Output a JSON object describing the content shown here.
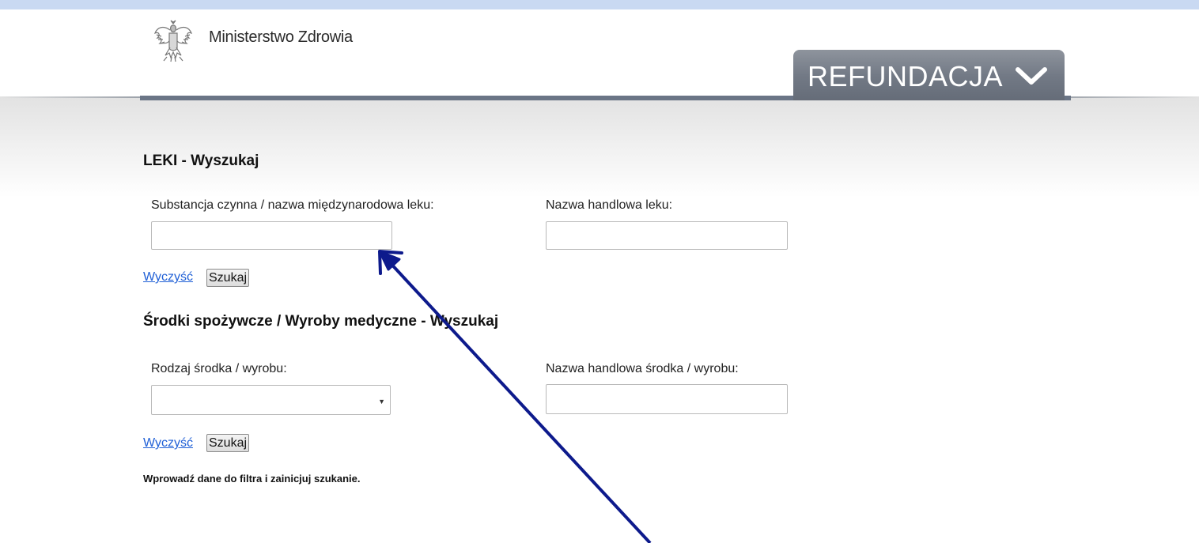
{
  "header": {
    "ministry_name": "Ministerstwo Zdrowia",
    "section_tab": "REFUNDACJA",
    "tab_icon": "chevron-down-icon"
  },
  "drugs_search": {
    "title": "LEKI - Wyszukaj",
    "substance_label": "Substancja czynna / nazwa międzynarodowa leku:",
    "substance_value": "",
    "trade_name_label": "Nazwa handlowa leku:",
    "trade_name_value": "",
    "clear_link": "Wyczyść",
    "search_button": "Szukaj"
  },
  "food_devices_search": {
    "title": "Środki spożywcze / Wyroby medyczne - Wyszukaj",
    "type_label": "Rodzaj środka / wyrobu:",
    "type_selected": "",
    "trade_name_label": "Nazwa handlowa środka / wyrobu:",
    "trade_name_value": "",
    "clear_link": "Wyczyść",
    "search_button": "Szukaj"
  },
  "status_message": "Wprowadź dane do filtra i zainicjuj szukanie.",
  "colors": {
    "top_strip": "#c9d9f2",
    "tab_background": "#737a86",
    "link": "#1f5fd6",
    "annotation_arrow": "#0d1a8c"
  }
}
